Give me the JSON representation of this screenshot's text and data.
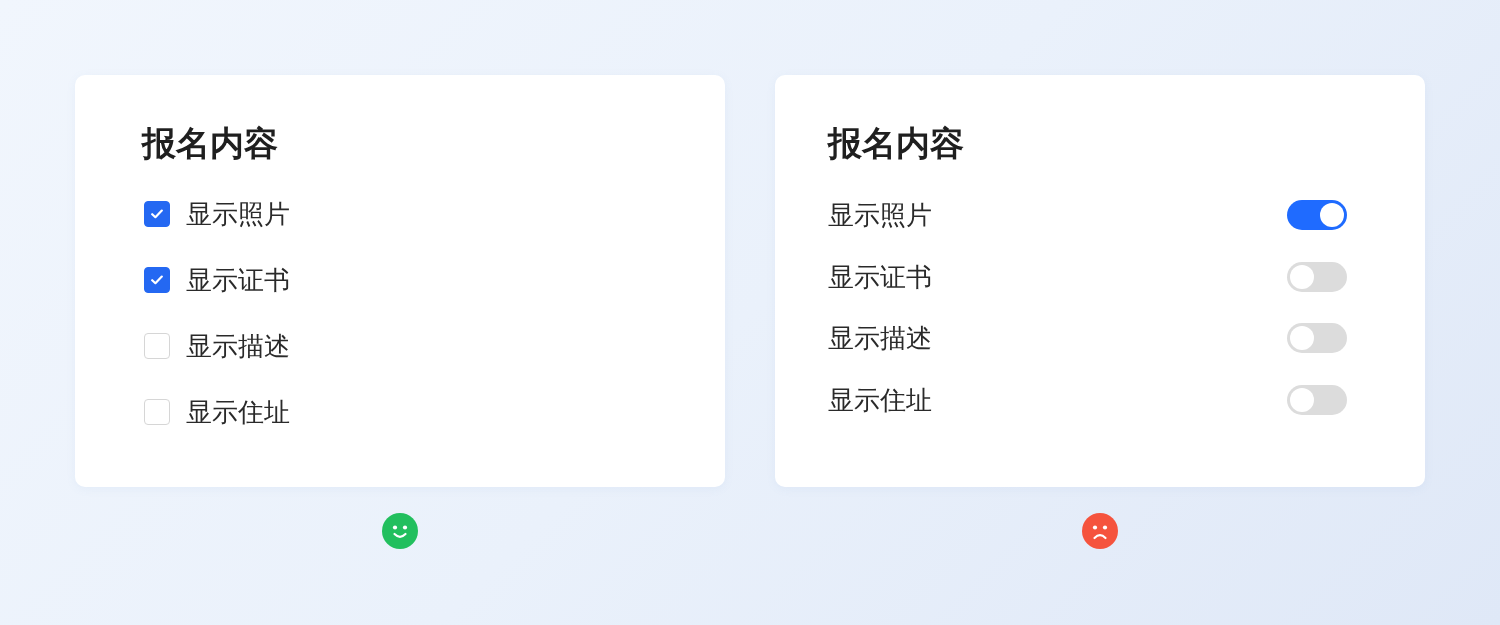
{
  "panels": [
    {
      "kind": "checkbox",
      "title": "报名内容",
      "face": {
        "kind": "happy"
      },
      "items": [
        {
          "label": "显示照片",
          "checked": true
        },
        {
          "label": "显示证书",
          "checked": true
        },
        {
          "label": "显示描述",
          "checked": false
        },
        {
          "label": "显示住址",
          "checked": false
        }
      ]
    },
    {
      "kind": "switch",
      "title": "报名内容",
      "face": {
        "kind": "sad"
      },
      "items": [
        {
          "label": "显示照片",
          "on": true
        },
        {
          "label": "显示证书",
          "on": false
        },
        {
          "label": "显示描述",
          "on": false
        },
        {
          "label": "显示住址",
          "on": false
        }
      ]
    }
  ]
}
